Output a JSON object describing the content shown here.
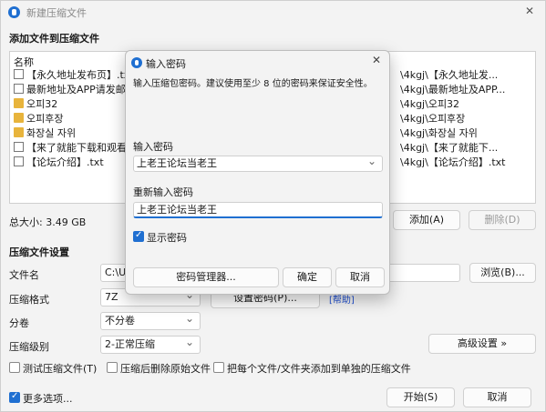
{
  "main": {
    "title": "新建压缩文件",
    "close": "✕",
    "section_add": "添加文件到压缩文件",
    "list_header": "名称",
    "files": [
      {
        "name": "【永久地址发布页】.txt",
        "type": "file",
        "path": "\\4kgj\\【永久地址发..."
      },
      {
        "name": "最新地址及APP请发邮箱自",
        "type": "file",
        "path": "\\4kgj\\最新地址及APP..."
      },
      {
        "name": "오피32",
        "type": "folder",
        "path": "\\4kgj\\오피32"
      },
      {
        "name": "오피후장",
        "type": "folder",
        "path": "\\4kgj\\오피후장"
      },
      {
        "name": "화장실 자위",
        "type": "folder",
        "path": "\\4kgj\\화장실 자위"
      },
      {
        "name": "【来了就能下载和观看！纟",
        "type": "file",
        "path": "\\4kgj\\【来了就能下..."
      },
      {
        "name": "【论坛介绍】.txt",
        "type": "file",
        "path": "\\4kgj\\【论坛介绍】.txt"
      }
    ],
    "total_size": "总大小: 3.49 GB",
    "add_button": "添加(A)",
    "delete_button": "删除(D)",
    "section_settings": "压缩文件设置",
    "filename_label": "文件名",
    "filename_value": "C:\\Us",
    "browse_button": "浏览(B)...",
    "format_label": "压缩格式",
    "format_value": "7Z",
    "set_password_button": "设置密码(P)...",
    "help_link": "[帮助]",
    "split_label": "分卷",
    "split_value": "不分卷",
    "level_label": "压缩级别",
    "level_value": "2-正常压缩",
    "advanced_button": "高级设置 »",
    "test_check": "测试压缩文件(T)",
    "delete_after_check": "压缩后删除原始文件",
    "separate_check": "把每个文件/文件夹添加到单独的压缩文件",
    "more_options": "更多选项...",
    "start_button": "开始(S)",
    "cancel_button": "取消"
  },
  "dialog": {
    "title": "输入密码",
    "close": "✕",
    "description": "输入压缩包密码。建议使用至少 8 位的密码来保证安全性。",
    "password_label": "输入密码",
    "password_value": "上老王论坛当老王",
    "reenter_label": "重新输入密码",
    "reenter_value": "上老王论坛当老王",
    "show_password": "显示密码",
    "manager_button": "密码管理器...",
    "ok_button": "确定",
    "cancel_button": "取消"
  },
  "colors": {
    "accent": "#1f6fd1",
    "folder": "#e8b43c"
  }
}
